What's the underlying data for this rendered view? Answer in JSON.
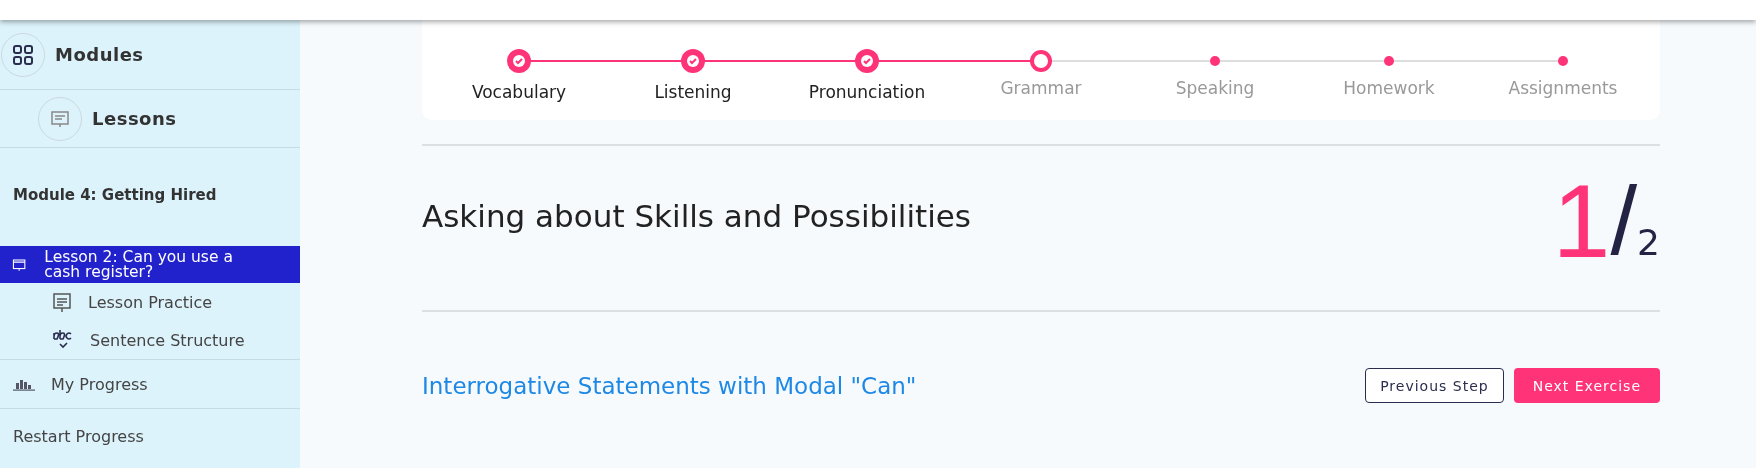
{
  "sidebar": {
    "nav": [
      {
        "label": "Modules",
        "kind": "modules"
      },
      {
        "label": "Lessons",
        "kind": "lessons"
      }
    ],
    "module_title": "Module 4: Getting Hired",
    "lesson": {
      "label": "Lesson 2: Can you use a cash register?",
      "selected": true
    },
    "lesson_items": [
      {
        "label": "Lesson Practice",
        "kind": "practice"
      },
      {
        "label": "Sentence Structure",
        "kind": "abc"
      }
    ],
    "progress": "My Progress",
    "restart": "Restart Progress"
  },
  "steps": [
    {
      "label": "Vocabulary",
      "completed": true,
      "current": false
    },
    {
      "label": "Listening",
      "completed": true,
      "current": false
    },
    {
      "label": "Pronunciation",
      "completed": true,
      "current": false
    },
    {
      "label": "Grammar",
      "completed": false,
      "current": true
    },
    {
      "label": "Speaking",
      "completed": false,
      "current": false
    },
    {
      "label": "Homework",
      "completed": false,
      "current": false
    },
    {
      "label": "Assignments",
      "completed": false,
      "current": false
    }
  ],
  "title": "Asking about Skills and Possibilities",
  "counter": {
    "current": "1",
    "separator": "/",
    "total": "2"
  },
  "exercise_title": "Interrogative Statements with Modal \"Can\"",
  "buttons": [
    {
      "label": "Previous Step",
      "kind": "secondary"
    },
    {
      "label": "Next Exercise",
      "kind": "primary"
    }
  ]
}
